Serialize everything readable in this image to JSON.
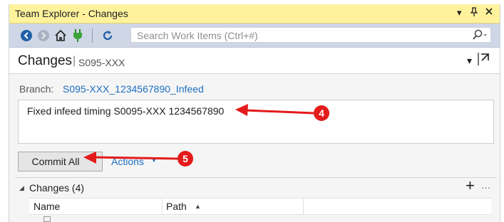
{
  "window": {
    "title": "Team Explorer - Changes",
    "controls": {
      "dropdown": "▾",
      "pin": "🖈",
      "close": "✕"
    }
  },
  "toolbar": {
    "back_icon": "back-circle-icon",
    "forward_icon": "forward-circle-icon",
    "home_icon": "home-icon",
    "connect_icon": "plug-icon",
    "refresh_icon": "refresh-icon",
    "search_placeholder": "Search Work Items (Ctrl+#)"
  },
  "header": {
    "title": "Changes",
    "separator": "|",
    "subtitle": "S095-XXX",
    "dropdown": "▾",
    "popout": "⇱"
  },
  "branch": {
    "label": "Branch:",
    "name": "S095-XXX_1234567890_Infeed"
  },
  "commit_message": "Fixed infeed timing S0095-XXX 1234567890",
  "buttons": {
    "commit_all": "Commit All",
    "actions": "Actions"
  },
  "changes_section": {
    "title": "Changes (4)",
    "add": "+",
    "more": "···",
    "columns": {
      "name": "Name",
      "path": "Path"
    }
  },
  "annotations": [
    {
      "label": "4",
      "target": "commit-message"
    },
    {
      "label": "5",
      "target": "commit-all-button"
    }
  ],
  "colors": {
    "titlebar": "#fff29d",
    "toolbar": "#cfd6e5",
    "link": "#1e6fc1",
    "annotation_red": "#e31b1b"
  }
}
